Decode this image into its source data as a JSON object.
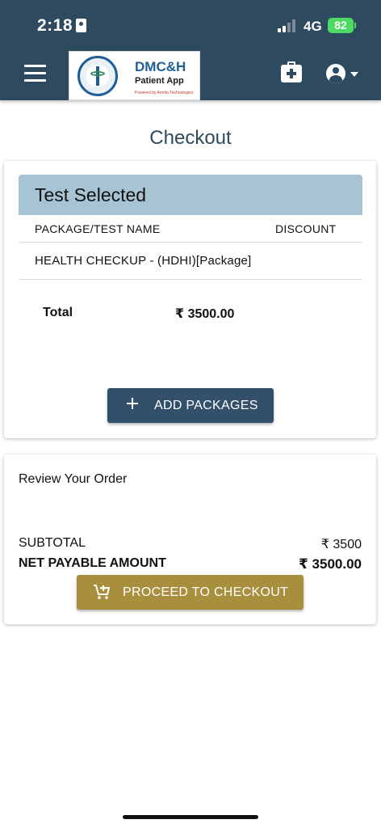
{
  "status_bar": {
    "time": "2:18",
    "network": "4G",
    "battery": "82"
  },
  "app_bar": {
    "logo": {
      "title": "DMC&H",
      "subtitle": "Patient App",
      "powered_by": "Powered by Amrita Technologies"
    },
    "icons": [
      "menu-icon",
      "medical-kit-icon",
      "account-icon",
      "caret-down-icon"
    ]
  },
  "page": {
    "title": "Checkout"
  },
  "tests_card": {
    "header": "Test Selected",
    "columns": [
      "PACKAGE/TEST NAME",
      "DISCOUNT"
    ],
    "rows": [
      {
        "name": "HEALTH CHECKUP - (HDHI)[Package]",
        "discount": ""
      }
    ],
    "total_label": "Total",
    "total_value": "₹ 3500.00",
    "add_button_label": "ADD PACKAGES"
  },
  "order_card": {
    "title": "Review Your Order",
    "subtotal_label": "SUBTOTAL",
    "subtotal_value": "₹ 3500",
    "net_label": "NET PAYABLE AMOUNT",
    "net_value": "₹ 3500.00",
    "checkout_button_label": "PROCEED TO CHECKOUT"
  },
  "colors": {
    "header_bg": "#2e4a5e",
    "title_color": "#2e4a5e",
    "table_header_bg": "#a7c4d4",
    "primary_button": "#32506a",
    "checkout_button": "#a88f3e",
    "battery": "#4cd964"
  }
}
